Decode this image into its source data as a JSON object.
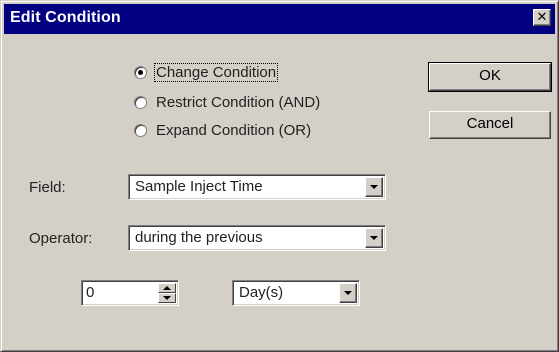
{
  "window": {
    "title": "Edit Condition",
    "close_glyph": "✕"
  },
  "mode": {
    "options": [
      {
        "label": "Change Condition",
        "checked": true
      },
      {
        "label": "Restrict Condition (AND)",
        "checked": false
      },
      {
        "label": "Expand Condition (OR)",
        "checked": false
      }
    ]
  },
  "buttons": {
    "ok_label": "OK",
    "cancel_label": "Cancel"
  },
  "field": {
    "label": "Field:",
    "value": "Sample Inject Time"
  },
  "operator": {
    "label": "Operator:",
    "value": "during the previous"
  },
  "amount": {
    "value": "0"
  },
  "unit": {
    "value": "Day(s)"
  },
  "icons": {
    "close": "close-icon",
    "dropdown": "chevron-down-icon",
    "spin_up": "spin-up-icon",
    "spin_down": "spin-down-icon"
  }
}
